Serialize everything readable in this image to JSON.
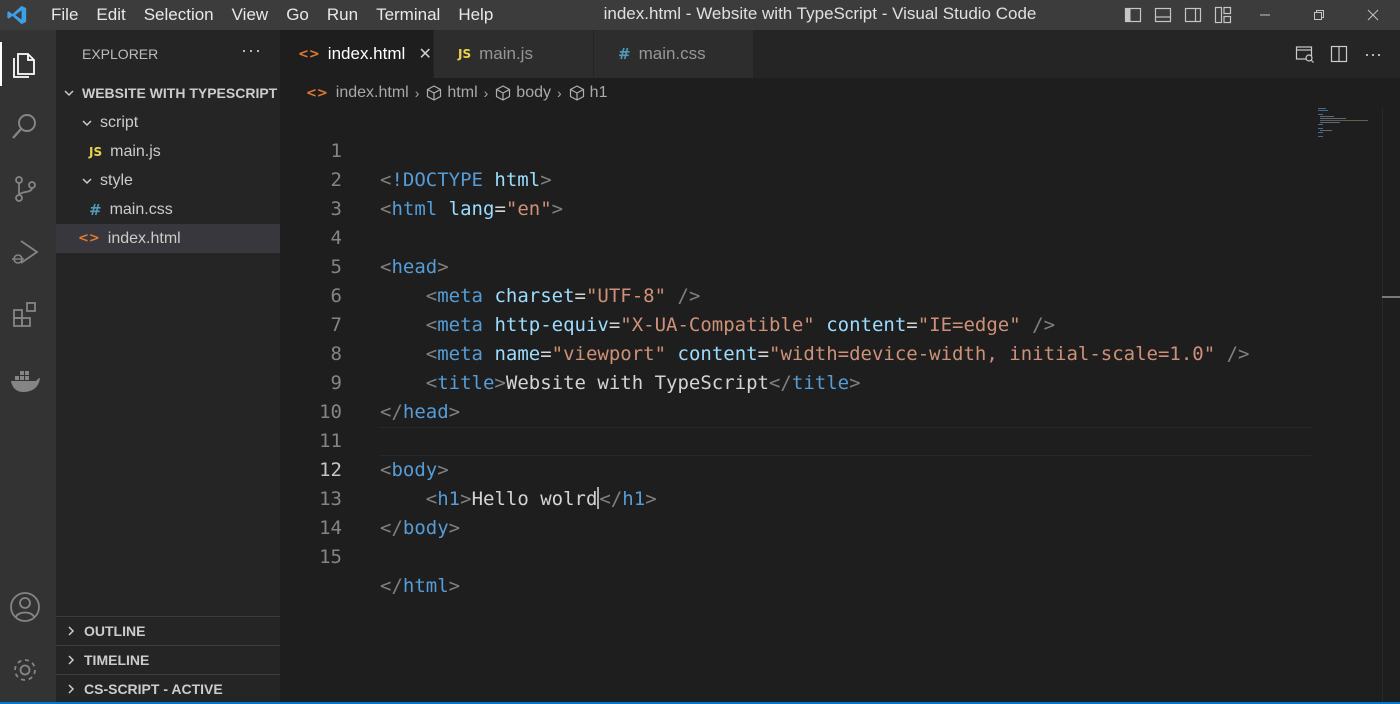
{
  "titlebar": {
    "menu": [
      "File",
      "Edit",
      "Selection",
      "View",
      "Go",
      "Run",
      "Terminal",
      "Help"
    ],
    "title": "index.html - Website with TypeScript - Visual Studio Code",
    "logo_color": "#3ca0e8"
  },
  "activity_bar": {
    "items": [
      "explorer-icon",
      "search-icon",
      "source-control-icon",
      "run-debug-icon",
      "extensions-icon",
      "docker-icon",
      "account-icon",
      "settings-gear-icon"
    ]
  },
  "sidebar": {
    "header": "EXPLORER",
    "more": "···",
    "project": "WEBSITE WITH TYPESCRIPT",
    "tree": {
      "script_folder": "script",
      "main_js": "main.js",
      "style_folder": "style",
      "main_css": "main.css",
      "index_html": "index.html"
    },
    "sections": {
      "outline": "OUTLINE",
      "timeline": "TIMELINE",
      "cs_script": "CS-SCRIPT - ACTIVE"
    }
  },
  "tabs": [
    {
      "label": "index.html",
      "badge": "<>",
      "active": true
    },
    {
      "label": "main.js",
      "badge": "JS",
      "active": false
    },
    {
      "label": "main.css",
      "badge": "#",
      "active": false
    }
  ],
  "breadcrumb": {
    "file": "index.html",
    "items": [
      "html",
      "body",
      "h1"
    ]
  },
  "editor": {
    "current_line": 12,
    "line_numbers": [
      "1",
      "2",
      "3",
      "4",
      "5",
      "6",
      "7",
      "8",
      "9",
      "10",
      "11",
      "12",
      "13",
      "14",
      "15"
    ],
    "tokens": {
      "l1_tag": "!DOCTYPE",
      "l1_attr": "html",
      "l2_tag": "html",
      "l2_attr": "lang",
      "l2_val": "\"en\"",
      "l4_tag": "head",
      "l5_tag": "meta",
      "l5_attr": "charset",
      "l5_val": "\"UTF-8\"",
      "l6_tag": "meta",
      "l6_attr1": "http-equiv",
      "l6_val1": "\"X-UA-Compatible\"",
      "l6_attr2": "content",
      "l6_val2": "\"IE=edge\"",
      "l7_tag": "meta",
      "l7_attr1": "name",
      "l7_val1": "\"viewport\"",
      "l7_attr2": "content",
      "l7_val2": "\"width=device-width, initial-scale=1.0\"",
      "l8_tag": "title",
      "l8_text": "Website with TypeScript",
      "l8_close": "title",
      "l9_tag": "head",
      "l11_tag": "body",
      "l12_tag": "h1",
      "l12_text": "Hello wolrd",
      "l12_close": "h1",
      "l13_tag": "body",
      "l15_tag": "html"
    }
  }
}
